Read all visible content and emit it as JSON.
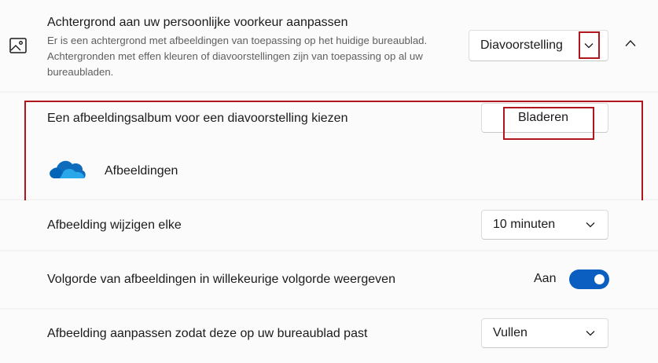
{
  "background": {
    "title": "Achtergrond aan uw persoonlijke voorkeur aanpassen",
    "description": "Er is een achtergrond met afbeeldingen van toepassing op het huidige bureaublad. Achtergronden met effen kleuren of diavoorstellingen zijn van toepassing op al uw bureaubladen.",
    "selected": "Diavoorstelling",
    "icon": "picture-icon"
  },
  "album": {
    "label": "Een afbeeldingsalbum voor een diavoorstelling kiezen",
    "browse_label": "Bladeren",
    "folder_name": "Afbeeldingen",
    "folder_icon": "onedrive-cloud-icon"
  },
  "interval": {
    "label": "Afbeelding wijzigen elke",
    "selected": "10 minuten"
  },
  "shuffle": {
    "label": "Volgorde van afbeeldingen in willekeurige volgorde weergeven",
    "state_label": "Aan",
    "on": true
  },
  "fit": {
    "label": "Afbeelding aanpassen zodat deze op uw bureaublad past",
    "selected": "Vullen"
  },
  "colors": {
    "accent": "#0a5fc0",
    "highlight": "#b0161c"
  }
}
